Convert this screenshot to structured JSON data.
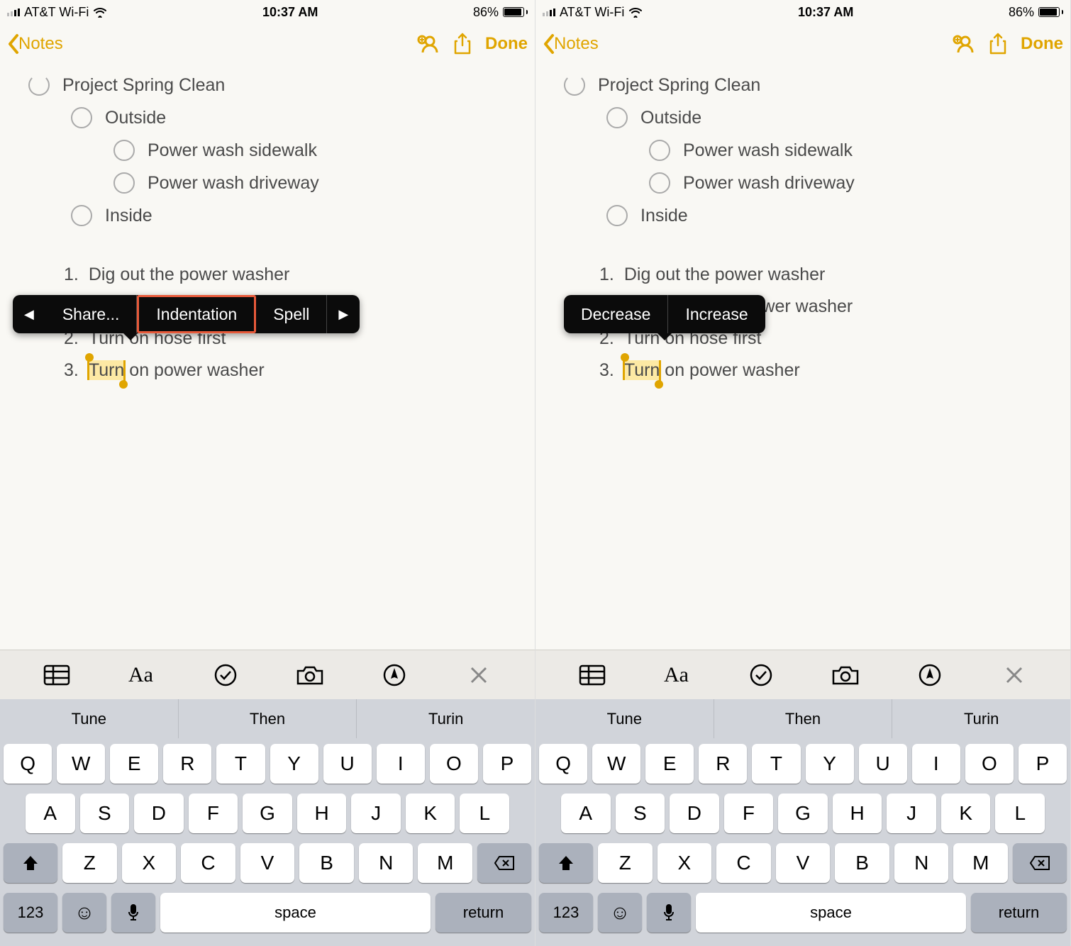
{
  "statusbar": {
    "carrier": "AT&T Wi-Fi",
    "time": "10:37 AM",
    "battery_pct": "86%",
    "battery_fill_pct": 86
  },
  "navbar": {
    "back": "Notes",
    "done": "Done"
  },
  "note": {
    "title": "Project Spring Clean",
    "outside": "Outside",
    "p1": "Power wash sidewalk",
    "p2": "Power wash driveway",
    "inside": "Inside",
    "num1": "Dig out the power washer",
    "num2_pre": "Attach hose to power washer",
    "num3": "Turn on hose first",
    "selected": "Turn",
    "num4_rest": " on power washer",
    "ord1": "1.",
    "ord2": "2.",
    "ord3": "2.",
    "ord4": "3."
  },
  "context_left": {
    "share": "Share...",
    "indentation": "Indentation",
    "spell": "Spell"
  },
  "context_right": {
    "decrease": "Decrease",
    "increase": "Increase"
  },
  "predictive": {
    "s1": "Tune",
    "s2": "Then",
    "s3": "Turin"
  },
  "keyboard": {
    "row1": [
      "Q",
      "W",
      "E",
      "R",
      "T",
      "Y",
      "U",
      "I",
      "O",
      "P"
    ],
    "row2": [
      "A",
      "S",
      "D",
      "F",
      "G",
      "H",
      "J",
      "K",
      "L"
    ],
    "row3": [
      "Z",
      "X",
      "C",
      "V",
      "B",
      "N",
      "M"
    ],
    "num": "123",
    "space": "space",
    "return": "return"
  }
}
